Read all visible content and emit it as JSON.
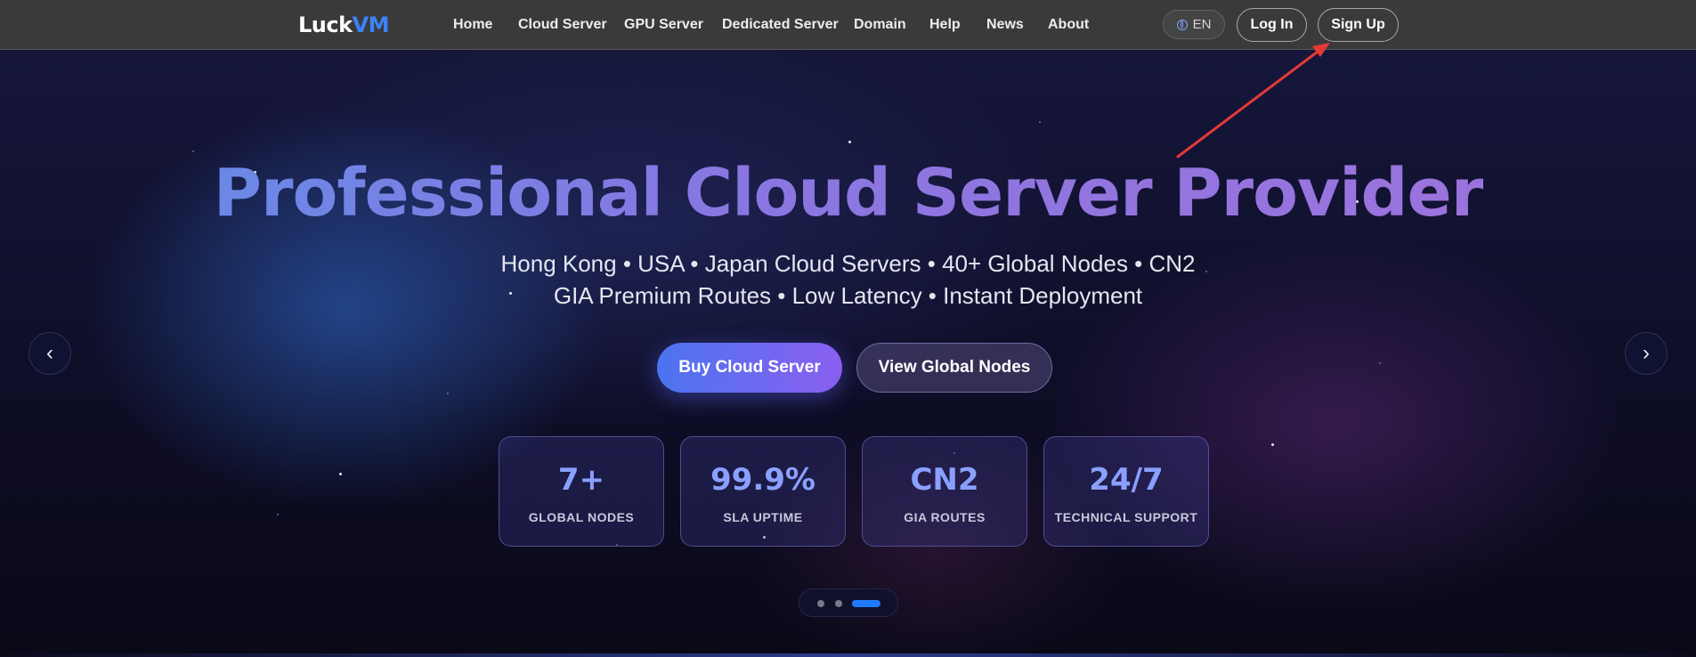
{
  "nav": {
    "logo_part1": "Luck",
    "logo_part2": "VM",
    "items": [
      "Home",
      "Cloud Server",
      "GPU Server",
      "Dedicated Server",
      "Domain",
      "Help",
      "News",
      "About"
    ],
    "lang": "EN",
    "login": "Log In",
    "signup": "Sign Up"
  },
  "hero": {
    "title": "Professional Cloud Server Provider",
    "subtitle_line1": "Hong Kong  •  USA  •  Japan Cloud Servers  •  40+ Global Nodes  •  CN2",
    "subtitle_line2": "GIA Premium Routes  •  Low Latency  •  Instant Deployment",
    "cta_primary": "Buy Cloud Server",
    "cta_secondary": "View Global Nodes",
    "prev": "‹",
    "next": "›",
    "stats": [
      {
        "value": "7+",
        "label": "GLOBAL NODES"
      },
      {
        "value": "99.9%",
        "label": "SLA UPTIME"
      },
      {
        "value": "CN2",
        "label": "GIA ROUTES"
      },
      {
        "value": "24/7",
        "label": "TECHNICAL SUPPORT"
      }
    ],
    "carousel_active_slide": 3,
    "carousel_slide_count": 3
  },
  "colors": {
    "nav_bg": "#3a3a3a",
    "brand_accent": "#3b82f6",
    "annotation_arrow": "#e53935"
  }
}
